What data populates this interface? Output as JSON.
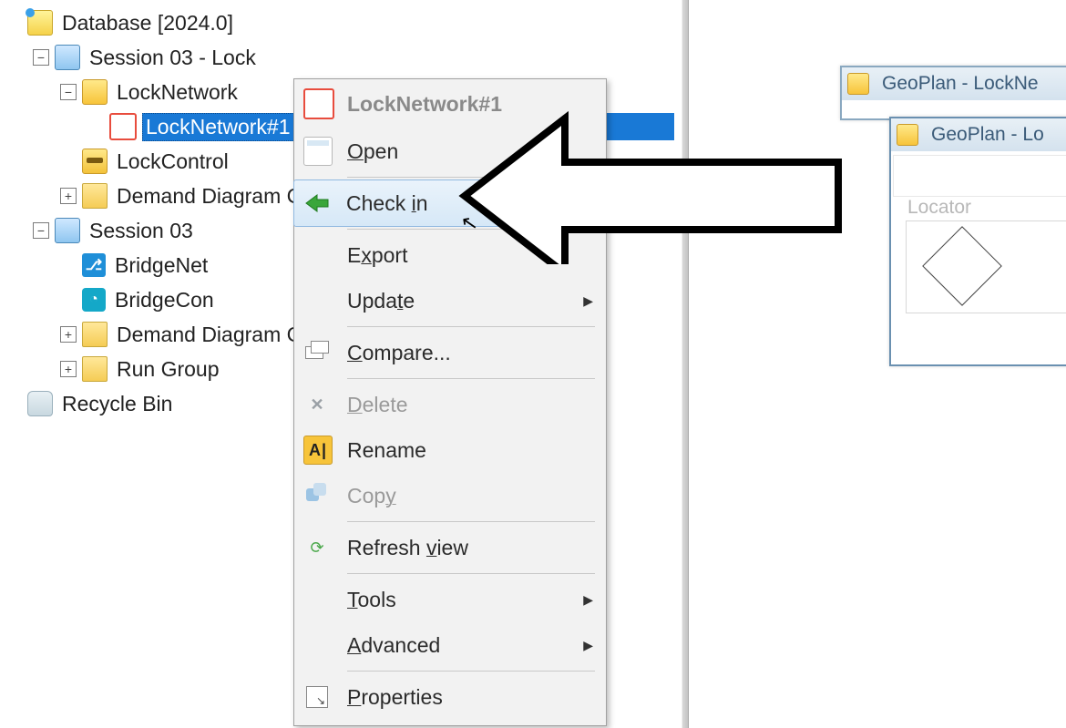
{
  "tree": {
    "root_label": "Database [2024.0]",
    "session_lock": "Session 03 - Lock",
    "lock_network": "LockNetwork",
    "lock_network_1": "LockNetwork#1",
    "lock_control": "LockControl",
    "demand_group_1": "Demand Diagram Gro",
    "session_03": "Session 03",
    "bridge_net": "BridgeNet",
    "bridge_con": "BridgeCon",
    "demand_group_2": "Demand Diagram Gro",
    "run_group": "Run Group",
    "recycle_bin": "Recycle Bin"
  },
  "menu": {
    "title": "LockNetwork#1",
    "open": "Open",
    "check_in": "Check in",
    "export": "Export",
    "update": "Update",
    "compare": "Compare...",
    "delete": "Delete",
    "rename": "Rename",
    "copy": "Copy",
    "refresh": "Refresh view",
    "tools": "Tools",
    "advanced": "Advanced",
    "properties": "Properties"
  },
  "windows": {
    "w1_title": "GeoPlan - LockNe",
    "w2_title": "GeoPlan - Lo",
    "locator": "Locator"
  }
}
